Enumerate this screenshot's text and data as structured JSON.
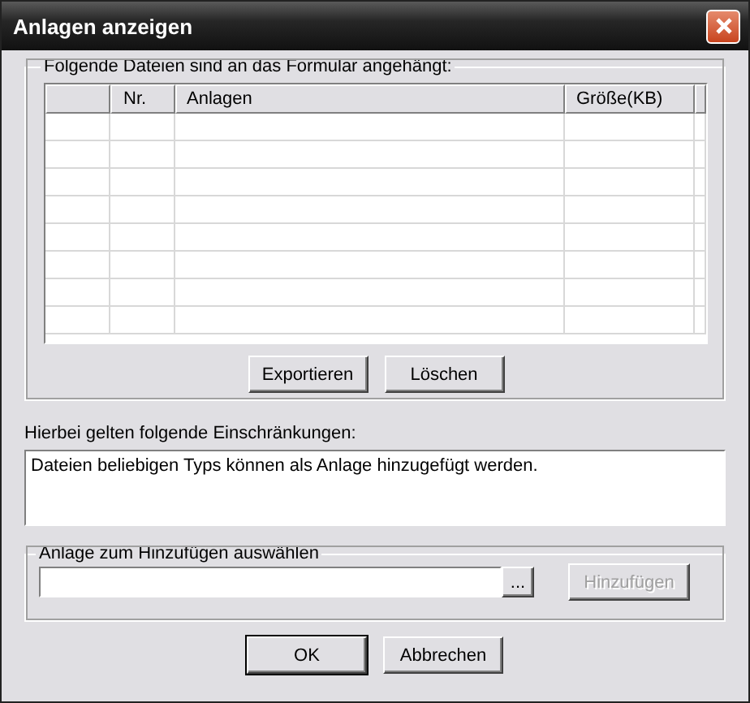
{
  "window": {
    "title": "Anlagen anzeigen"
  },
  "attachments": {
    "legend": "Folgende Dateien sind an das Formular angehängt:",
    "columns": [
      "Nr.",
      "Anlagen",
      "Größe(KB)"
    ],
    "buttons": [
      {
        "label": "Exportieren",
        "disabled": false
      },
      {
        "label": "Löschen",
        "disabled": false
      }
    ]
  },
  "restrictions": {
    "label": "Hierbei gelten folgende Einschränkungen:",
    "text": "Dateien beliebigen Typs können als Anlage hinzugefügt werden."
  },
  "add": {
    "legend": "Anlage zum Hinzufügen auswählen",
    "browse": "...",
    "button": {
      "label": "Hinzufügen",
      "disabled": true
    }
  },
  "buttons": [
    {
      "label": "OK",
      "default": true
    },
    {
      "label": "Abbrechen",
      "default": false
    }
  ]
}
